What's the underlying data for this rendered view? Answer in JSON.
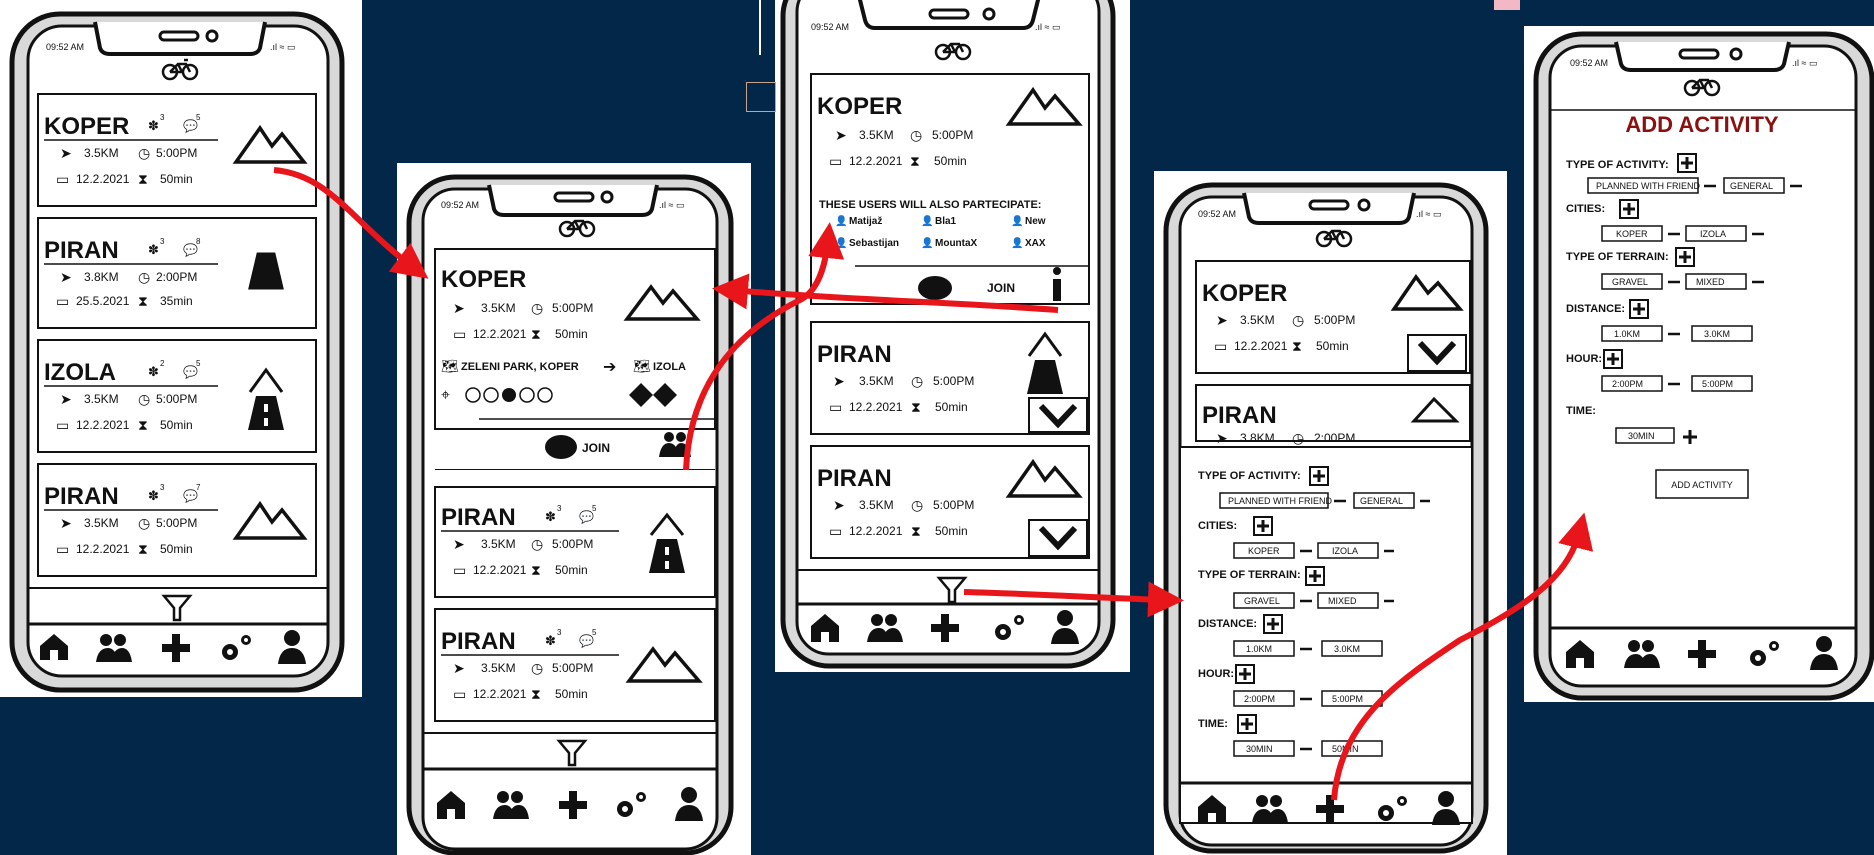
{
  "status_time": "09:52 AM",
  "nav_items": [
    "home-icon",
    "users-icon",
    "add-icon",
    "settings-icon",
    "profile-icon"
  ],
  "colors": {
    "background": "#022748",
    "arrow": "#e8151b",
    "title": "#8b1010"
  },
  "cards": {
    "koper": {
      "city": "KOPER",
      "dist": "3.5KM",
      "time": "5:00PM",
      "date": "12.2.2021",
      "dur": "50min",
      "users": "3",
      "comments": "5"
    },
    "piran_a": {
      "city": "PIRAN",
      "dist": "3.8KM",
      "time": "2:00PM",
      "date": "25.5.2021",
      "dur": "35min",
      "users": "3",
      "comments": "8"
    },
    "izola": {
      "city": "IZOLA",
      "dist": "3.5KM",
      "time": "5:00PM",
      "date": "12.2.2021",
      "dur": "50min",
      "users": "2",
      "comments": "5"
    },
    "piran_b": {
      "city": "PIRAN",
      "dist": "3.5KM",
      "time": "5:00PM",
      "date": "12.2.2021",
      "dur": "50min",
      "users": "3",
      "comments": "7"
    },
    "piran_c": {
      "city": "PIRAN",
      "dist": "3.5KM",
      "time": "5:00PM",
      "date": "12.2.2021",
      "dur": "50min",
      "users": "3",
      "comments": "5"
    },
    "piran_d": {
      "city": "PIRAN",
      "dist": "3.5KM",
      "time": "5:00PM",
      "date": "12.2.2021",
      "dur": "50min"
    },
    "piran_e": {
      "city": "PIRAN",
      "dist": "3.5KM",
      "time": "5:00PM",
      "date": "12.2.2021",
      "dur": "50min"
    },
    "piran_f": {
      "city": "PIRAN",
      "dist": "3.8KM",
      "time": "2:00PM"
    }
  },
  "expanded": {
    "route_from": "ZELENI PARK, KOPER",
    "route_to": "IZOLA",
    "join": "JOIN"
  },
  "participants": {
    "heading": "THESE USERS WILL ALSO PARTECIPATE:",
    "users": [
      "Matijaž",
      "Bla1",
      "New",
      "Sebastijan",
      "MountaX",
      "XAX"
    ],
    "join": "JOIN"
  },
  "filter": {
    "type_label": "TYPE OF ACTIVITY:",
    "type_values": [
      "PLANNED WITH FRIEND",
      "GENERAL"
    ],
    "cities_label": "CITIES:",
    "cities_values": [
      "KOPER",
      "IZOLA"
    ],
    "terrain_label": "TYPE OF TERRAIN:",
    "terrain_values": [
      "GRAVEL",
      "MIXED"
    ],
    "distance_label": "DISTANCE:",
    "distance_values": [
      "1.0KM",
      "3.0KM"
    ],
    "hour_label": "HOUR:",
    "hour_values": [
      "2:00PM",
      "5:00PM"
    ],
    "time_label": "TIME:",
    "time_values": [
      "30MIN",
      "50MIN"
    ]
  },
  "add_activity": {
    "title": "ADD ACTIVITY",
    "type_label": "TYPE OF ACTIVITY:",
    "type_values": [
      "PLANNED WITH FRIEND",
      "GENERAL"
    ],
    "cities_label": "CITIES:",
    "cities_values": [
      "KOPER",
      "IZOLA"
    ],
    "terrain_label": "TYPE OF TERRAIN:",
    "terrain_values": [
      "GRAVEL",
      "MIXED"
    ],
    "distance_label": "DISTANCE:",
    "distance_values": [
      "1.0KM",
      "3.0KM"
    ],
    "hour_label": "HOUR:",
    "hour_values": [
      "2:00PM",
      "5:00PM"
    ],
    "time_label": "TIME:",
    "time_value": "30MIN",
    "button": "ADD ACTIVITY"
  }
}
